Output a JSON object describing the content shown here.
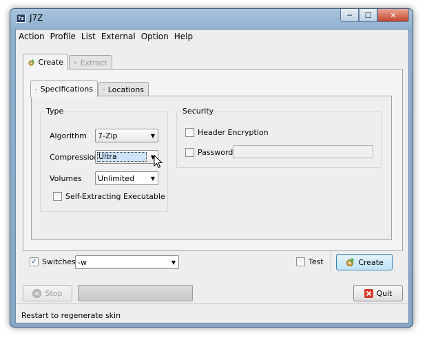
{
  "window": {
    "icon_text": "7z",
    "title": "J7Z",
    "controls": {
      "minimize": "─",
      "maximize": "☐",
      "close": "✕"
    }
  },
  "menu": [
    "Action",
    "Profile",
    "List",
    "External",
    "Option",
    "Help"
  ],
  "outer_tabs": [
    {
      "label": "Create",
      "icon": "gear-star-icon",
      "active": true
    },
    {
      "label": "Extract",
      "icon": "gear-icon",
      "active": false
    }
  ],
  "inner_tabs": [
    {
      "label": "Specifications",
      "icon": "bar-chart-icon",
      "active": true
    },
    {
      "label": "Locations",
      "icon": "folder-icon",
      "active": false
    }
  ],
  "type_group": {
    "title": "Type",
    "algorithm": {
      "label": "Algorithm",
      "value": "7-Zip"
    },
    "compression": {
      "label": "Compression",
      "value": "Ultra"
    },
    "volumes": {
      "label": "Volumes",
      "value": "Unlimited"
    },
    "sfx": {
      "label": "Self-Extracting Executable",
      "checked": false
    }
  },
  "security_group": {
    "title": "Security",
    "header_encryption": {
      "label": "Header Encryption",
      "checked": false
    },
    "password": {
      "label": "Password",
      "checked": false,
      "value": ""
    }
  },
  "bottom": {
    "switches": {
      "label": "Switches",
      "checked": true,
      "value": "-w",
      "check_glyph": "✓"
    },
    "test": {
      "label": "Test",
      "checked": false
    },
    "create_button": "Create",
    "stop_button": "Stop",
    "quit_button": "Quit",
    "progress": 0
  },
  "status": "Restart to regenerate skin",
  "arrow_glyph": "▼",
  "colors": {
    "accent": "#3c7fb1",
    "window_frame": "#8fb0cf",
    "close": "#c7452b"
  }
}
